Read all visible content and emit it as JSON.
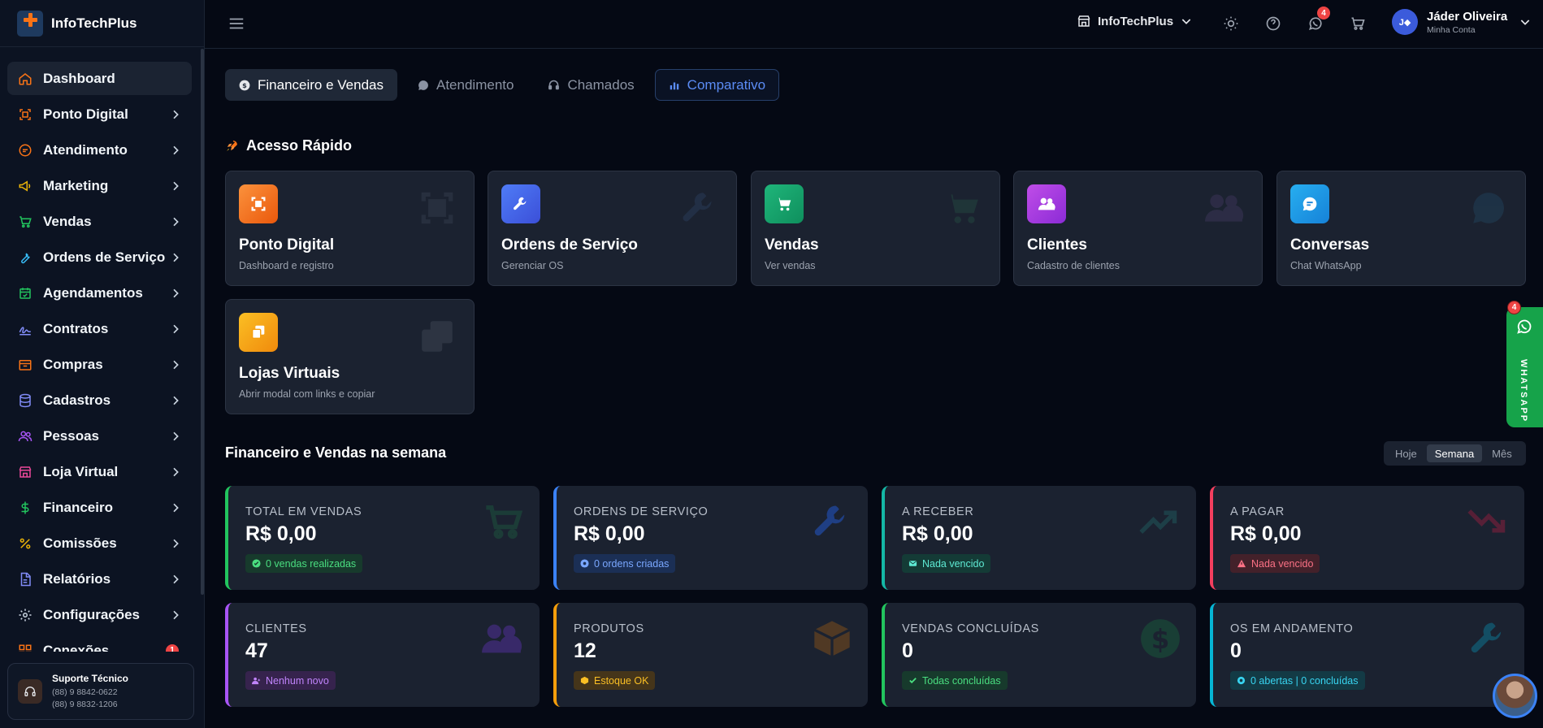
{
  "brand": {
    "name": "InfoTechPlus"
  },
  "sidebar": {
    "items": [
      {
        "label": "Dashboard",
        "icon": "home-icon",
        "color": "#f97316"
      },
      {
        "label": "Ponto Digital",
        "icon": "scan-icon",
        "color": "#f97316"
      },
      {
        "label": "Atendimento",
        "icon": "chat-icon",
        "color": "#f97316"
      },
      {
        "label": "Marketing",
        "icon": "megaphone-icon",
        "color": "#eab308"
      },
      {
        "label": "Vendas",
        "icon": "cart-icon",
        "color": "#22c55e"
      },
      {
        "label": "Ordens de Serviço",
        "icon": "wrench-icon",
        "color": "#38bdf8"
      },
      {
        "label": "Agendamentos",
        "icon": "calendar-icon",
        "color": "#22c55e"
      },
      {
        "label": "Contratos",
        "icon": "signature-icon",
        "color": "#818cf8"
      },
      {
        "label": "Compras",
        "icon": "store-icon",
        "color": "#f97316"
      },
      {
        "label": "Cadastros",
        "icon": "database-icon",
        "color": "#818cf8"
      },
      {
        "label": "Pessoas",
        "icon": "users-icon",
        "color": "#a855f7"
      },
      {
        "label": "Loja Virtual",
        "icon": "shop-icon",
        "color": "#ec4899"
      },
      {
        "label": "Financeiro",
        "icon": "dollar-icon",
        "color": "#22c55e"
      },
      {
        "label": "Comissões",
        "icon": "percent-icon",
        "color": "#eab308"
      },
      {
        "label": "Relatórios",
        "icon": "file-icon",
        "color": "#818cf8"
      },
      {
        "label": "Configurações",
        "icon": "gear-icon",
        "color": "#cbd5e1"
      },
      {
        "label": "Conexões",
        "icon": "grid-icon",
        "color": "#f97316",
        "badge": "1"
      }
    ],
    "support": {
      "title": "Suporte Técnico",
      "phone1": "(88) 9 8842-0622",
      "phone2": "(88) 9 8832-1206"
    }
  },
  "header": {
    "store": "InfoTechPlus",
    "notification_badge": "4",
    "user": {
      "initials": "J◆",
      "name": "Jáder Oliveira",
      "sub": "Minha Conta"
    }
  },
  "tabs": [
    {
      "label": "Financeiro e Vendas"
    },
    {
      "label": "Atendimento"
    },
    {
      "label": "Chamados"
    },
    {
      "label": "Comparativo"
    }
  ],
  "quick_access": {
    "title": "Acesso Rápido",
    "cards": [
      {
        "title": "Ponto Digital",
        "sub": "Dashboard e registro",
        "color": "#f97316"
      },
      {
        "title": "Ordens de Serviço",
        "sub": "Gerenciar OS",
        "color": "#3b63e6"
      },
      {
        "title": "Vendas",
        "sub": "Ver vendas",
        "color": "#16a36b"
      },
      {
        "title": "Clientes",
        "sub": "Cadastro de clientes",
        "color": "#a83ee0"
      },
      {
        "title": "Conversas",
        "sub": "Chat WhatsApp",
        "color": "#1e9be8"
      },
      {
        "title": "Lojas Virtuais",
        "sub": "Abrir modal com links e copiar",
        "color": "#f59e0b"
      }
    ]
  },
  "week": {
    "title": "Financeiro e Vendas na semana",
    "periods": [
      "Hoje",
      "Semana",
      "Mês"
    ],
    "selected_period": "Semana"
  },
  "stats": [
    {
      "label": "TOTAL EM VENDAS",
      "value": "R$ 0,00",
      "pill": "0 vendas realizadas",
      "color": "#22c55e"
    },
    {
      "label": "ORDENS DE SERVIÇO",
      "value": "R$ 0,00",
      "pill": "0 ordens criadas",
      "color": "#3b82f6"
    },
    {
      "label": "A RECEBER",
      "value": "R$ 0,00",
      "pill": "Nada vencido",
      "color": "#14b8a6"
    },
    {
      "label": "A PAGAR",
      "value": "R$ 0,00",
      "pill": "Nada vencido",
      "color": "#f43f5e"
    },
    {
      "label": "CLIENTES",
      "value": "47",
      "pill": "Nenhum novo",
      "color": "#a855f7"
    },
    {
      "label": "PRODUTOS",
      "value": "12",
      "pill": "Estoque OK",
      "color": "#f59e0b"
    },
    {
      "label": "VENDAS CONCLUÍDAS",
      "value": "0",
      "pill": "Todas concluídas",
      "color": "#22c55e"
    },
    {
      "label": "OS EM ANDAMENTO",
      "value": "0",
      "pill": "0 abertas | 0 concluídas",
      "color": "#06b6d4"
    }
  ],
  "whatsapp_tab": {
    "label": "WHATSAPP",
    "badge": "4"
  }
}
